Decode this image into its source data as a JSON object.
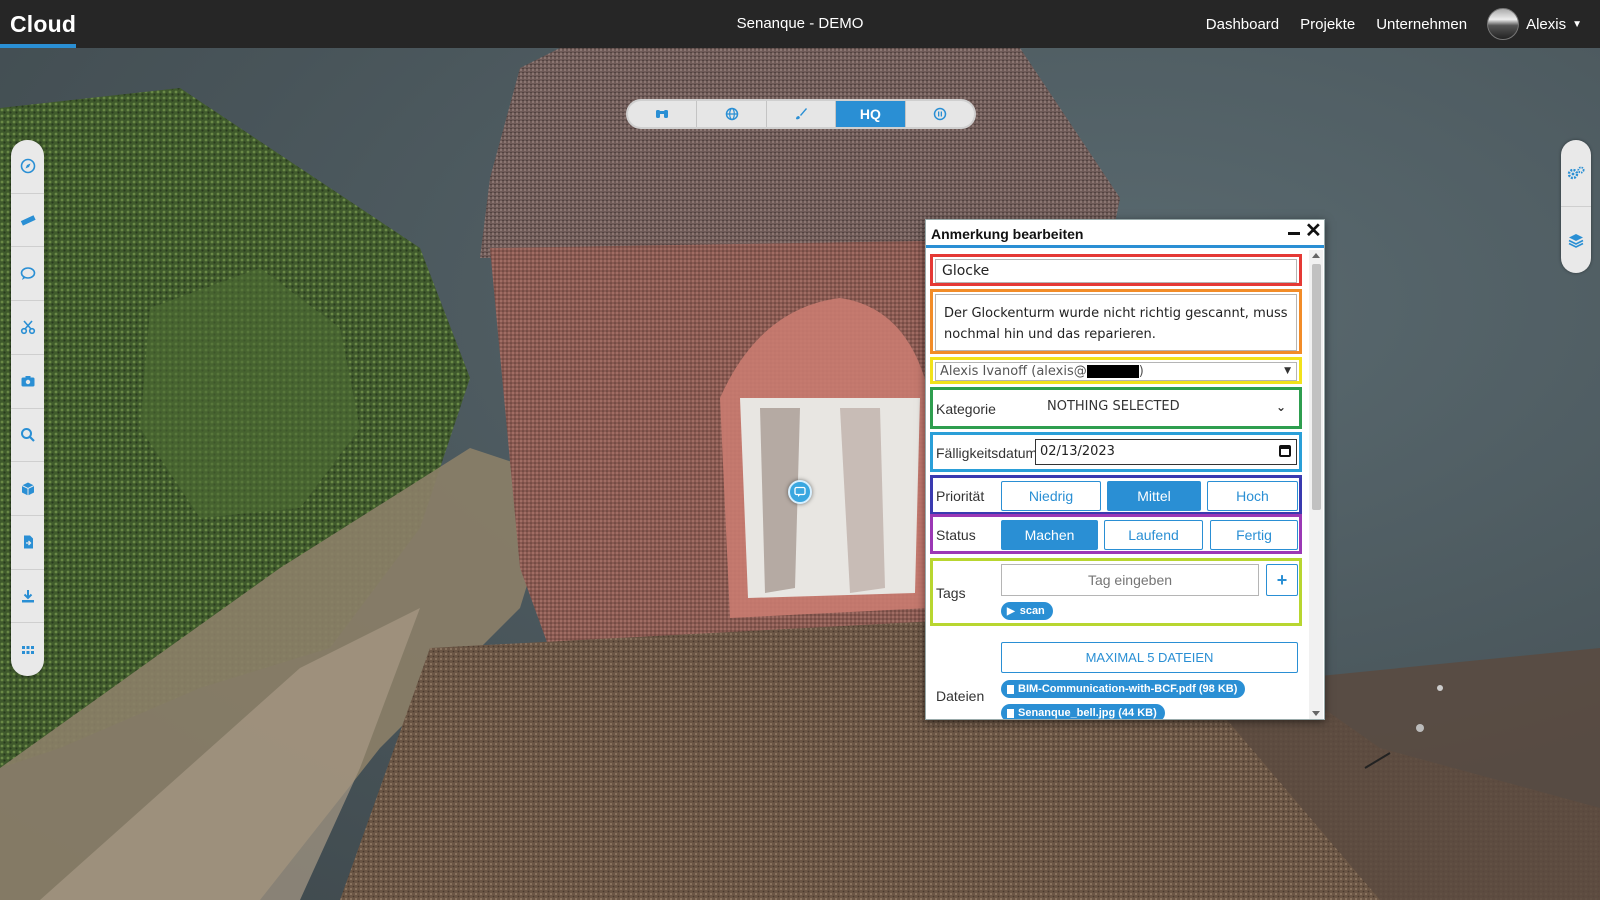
{
  "brand": {
    "name": "Cloud"
  },
  "header": {
    "project_title": "Senanque - DEMO",
    "nav": [
      "Dashboard",
      "Projekte",
      "Unternehmen"
    ],
    "user_name": "Alexis"
  },
  "view_toolbar": {
    "buttons": [
      {
        "icon": "binoculars-icon",
        "label": ""
      },
      {
        "icon": "globe-icon",
        "label": ""
      },
      {
        "icon": "brush-icon",
        "label": ""
      },
      {
        "icon": "hq-toggle",
        "label": "HQ",
        "active": true
      },
      {
        "icon": "pause-icon",
        "label": ""
      }
    ]
  },
  "left_toolbar": {
    "icons": [
      "compass-icon",
      "ruler-icon",
      "comment-icon",
      "scissors-icon",
      "camera-icon",
      "search-icon",
      "cube-icon",
      "file-import-icon",
      "download-icon",
      "grid-icon"
    ]
  },
  "right_toolbar": {
    "icons": [
      "settings-icon",
      "layers-icon"
    ]
  },
  "dialog": {
    "title": "Anmerkung bearbeiten",
    "title_value": "Glocke",
    "description": "Der Glockenturm wurde nicht richtig gescannt, muss nochmal hin und das reparieren.",
    "assignee_value": "Alexis Ivanoff (alexis@",
    "assignee_suffix": ")",
    "category_label": "Kategorie",
    "category_value": "NOTHING SELECTED",
    "due_label": "Fälligkeitsdatum",
    "due_value": "02/13/2023",
    "priority_label": "Priorität",
    "priority_options": [
      "Niedrig",
      "Mittel",
      "Hoch"
    ],
    "priority_selected": "Mittel",
    "status_label": "Status",
    "status_options": [
      "Machen",
      "Laufend",
      "Fertig"
    ],
    "status_selected": "Machen",
    "tags_label": "Tags",
    "tag_placeholder": "Tag eingeben",
    "add_tag_label": "+",
    "tags": [
      "scan"
    ],
    "files_label": "Dateien",
    "upload_label": "MAXIMAL 5 DATEIEN",
    "files": [
      "BIM-Communication-with-BCF.pdf (98 KB)",
      "Senanque_bell.jpg (44 KB)"
    ]
  },
  "colors": {
    "accent": "#2a8fd4",
    "topbar": "#262626",
    "box_title": "#e53935",
    "box_description": "#f28c28",
    "box_assignee": "#f2e21b",
    "box_category": "#2e9e4f",
    "box_due": "#2a9fd8",
    "box_priority": "#3a3ab0",
    "box_status": "#9b38b5",
    "box_tags": "#b8d630"
  }
}
